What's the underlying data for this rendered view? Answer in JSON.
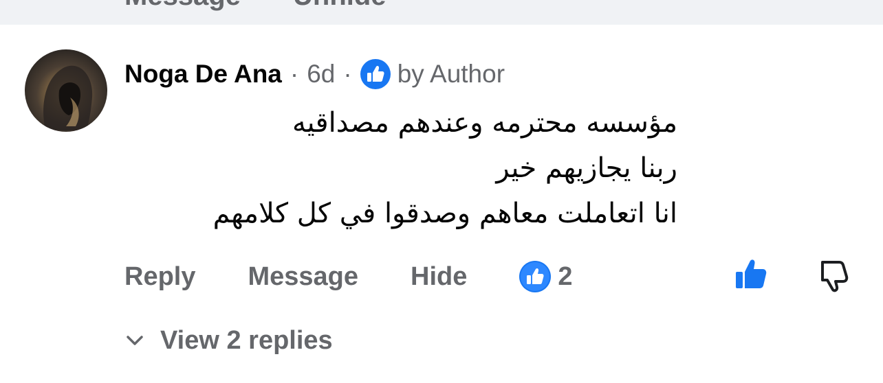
{
  "top_bar": {
    "prev_actions": [
      "Message",
      "Unhide"
    ]
  },
  "comment": {
    "author": "Noga De Ana",
    "separator": "·",
    "time": "6d",
    "badge_icon": "thumbs-up-badge-icon",
    "badge_label": "by Author",
    "body_lines": [
      "مؤسسه محترمه وعندهم مصداقيه",
      "ربنا يجازيهم خير",
      "انا اتعاملت معاهم وصدقوا في كل كلامهم"
    ],
    "actions": {
      "reply": "Reply",
      "message": "Message",
      "hide": "Hide"
    },
    "reaction_icon": "like-reaction-icon",
    "reaction_count": "2",
    "view_replies": "View 2 replies"
  },
  "colors": {
    "accent": "#1877f2",
    "text_primary": "#050505",
    "text_secondary": "#65676b",
    "top_bar_bg": "#f0f2f5"
  }
}
